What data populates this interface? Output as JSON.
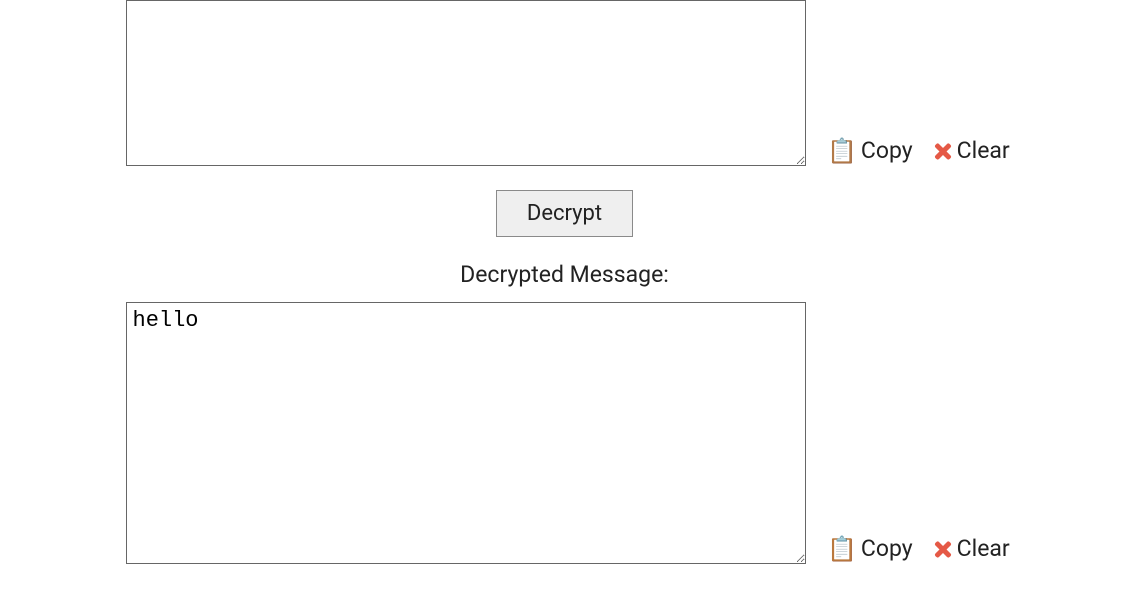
{
  "input": {
    "value": "",
    "actions": {
      "copy": "Copy",
      "clear": "Clear"
    }
  },
  "decrypt_button": "Decrypt",
  "output_label": "Decrypted Message:",
  "output": {
    "value": "hello",
    "actions": {
      "copy": "Copy",
      "clear": "Clear"
    }
  },
  "icons": {
    "clipboard": "clipboard-icon",
    "cross": "cross-icon"
  }
}
